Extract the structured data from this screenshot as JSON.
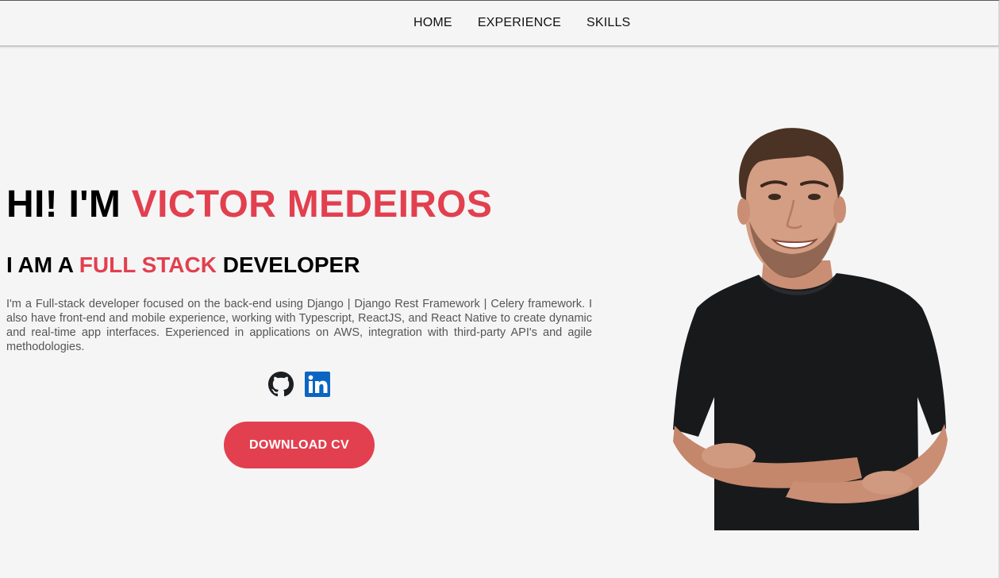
{
  "colors": {
    "accent": "#e2404f",
    "text": "#000000",
    "body_text": "#555555",
    "background": "#f5f5f5",
    "github": "#1b1f23",
    "linkedin": "#0a66c2"
  },
  "nav": {
    "items": [
      {
        "label": "HOME"
      },
      {
        "label": "EXPERIENCE"
      },
      {
        "label": "SKILLS"
      }
    ]
  },
  "hero": {
    "greeting": "HI! I'M ",
    "name": "VICTOR MEDEIROS",
    "subtitle_prefix": "I AM A ",
    "subtitle_highlight": "FULL STACK",
    "subtitle_suffix": " DEVELOPER",
    "bio": "I'm a Full-stack developer focused on the back-end using Django | Django Rest Framework | Celery framework. I also have front-end and mobile experience, working with Typescript, ReactJS, and React Native to create dynamic and real-time app interfaces. Experienced in applications on AWS, integration with third-party API's and agile methodologies."
  },
  "socials": [
    {
      "icon": "github-icon"
    },
    {
      "icon": "linkedin-icon"
    }
  ],
  "cta": {
    "label": "DOWNLOAD CV"
  },
  "portrait": {
    "icon": "portrait-photo"
  }
}
